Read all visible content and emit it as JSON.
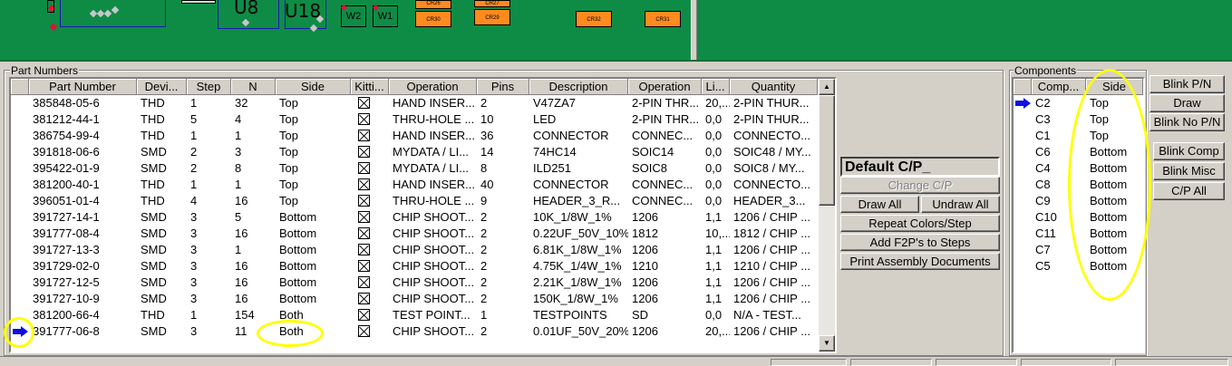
{
  "board": {
    "refs": {
      "u8": "U8",
      "u18": "U18",
      "w2": "W2",
      "w1": "W1"
    },
    "chips": {
      "cr26": "CR26",
      "cr30": "CR30",
      "cr27": "CR27",
      "cr29": "CR29",
      "cr32": "CR32",
      "cr31": "CR31"
    }
  },
  "parts": {
    "group_label": "Part Numbers",
    "columns": [
      "Part Number",
      "Devi...",
      "Step",
      "N",
      "Side",
      "Kitti...",
      "Operation",
      "Pins",
      "Description",
      "Operation",
      "Li...",
      "Quantity"
    ],
    "rows": [
      [
        "385848-05-6",
        "THD",
        "1",
        "32",
        "Top",
        "HAND INSER...",
        "2",
        "V47ZA7",
        "2-PIN THR...",
        "20,...",
        "2-PIN THUR..."
      ],
      [
        "381212-44-1",
        "THD",
        "5",
        "4",
        "Top",
        "THRU-HOLE ...",
        "10",
        "LED",
        "2-PIN THR...",
        "0,0",
        "2-PIN THUR..."
      ],
      [
        "386754-99-4",
        "THD",
        "1",
        "1",
        "Top",
        "HAND INSER...",
        "36",
        "CONNECTOR",
        "CONNEC...",
        "0,0",
        "CONNECTO..."
      ],
      [
        "391818-06-6",
        "SMD",
        "2",
        "3",
        "Top",
        "MYDATA / LI...",
        "14",
        "74HC14",
        "SOIC14",
        "0,0",
        "SOIC48 / MY..."
      ],
      [
        "395422-01-9",
        "SMD",
        "2",
        "8",
        "Top",
        "MYDATA / LI...",
        "8",
        "ILD251",
        "SOIC8",
        "0,0",
        "SOIC8 / MY..."
      ],
      [
        "381200-40-1",
        "THD",
        "1",
        "1",
        "Top",
        "HAND INSER...",
        "40",
        "CONNECTOR",
        "CONNEC...",
        "0,0",
        "CONNECTO..."
      ],
      [
        "396051-01-4",
        "THD",
        "4",
        "16",
        "Top",
        "THRU-HOLE ...",
        "9",
        "HEADER_3_R...",
        "CONNEC...",
        "0,0",
        "HEADER_3..."
      ],
      [
        "391727-14-1",
        "SMD",
        "3",
        "5",
        "Bottom",
        "CHIP SHOOT...",
        "2",
        "10K_1/8W_1%",
        "1206",
        "1,1",
        "1206 / CHIP ..."
      ],
      [
        "391777-08-4",
        "SMD",
        "3",
        "16",
        "Bottom",
        "CHIP SHOOT...",
        "2",
        "0.22UF_50V_10%",
        "1812",
        "10,...",
        "1812 / CHIP ..."
      ],
      [
        "391727-13-3",
        "SMD",
        "3",
        "1",
        "Bottom",
        "CHIP SHOOT...",
        "2",
        "6.81K_1/8W_1%",
        "1206",
        "1,1",
        "1206 / CHIP ..."
      ],
      [
        "391729-02-0",
        "SMD",
        "3",
        "16",
        "Bottom",
        "CHIP SHOOT...",
        "2",
        "4.75K_1/4W_1%",
        "1210",
        "1,1",
        "1210 / CHIP ..."
      ],
      [
        "391727-12-5",
        "SMD",
        "3",
        "16",
        "Bottom",
        "CHIP SHOOT...",
        "2",
        "2.21K_1/8W_1%",
        "1206",
        "1,1",
        "1206 / CHIP ..."
      ],
      [
        "391727-10-9",
        "SMD",
        "3",
        "16",
        "Bottom",
        "CHIP SHOOT...",
        "2",
        "150K_1/8W_1%",
        "1206",
        "1,1",
        "1206 / CHIP ..."
      ],
      [
        "381200-66-4",
        "THD",
        "1",
        "154",
        "Both",
        "TEST POINT...",
        "1",
        "TESTPOINTS",
        "SD",
        "0,0",
        "N/A - TEST..."
      ],
      [
        "391777-06-8",
        "SMD",
        "3",
        "11",
        "Both",
        "CHIP SHOOT...",
        "2",
        "0.01UF_50V_20%",
        "1206",
        "20,...",
        "1206 / CHIP ..."
      ]
    ],
    "selected_row": 14
  },
  "actions": {
    "cp_name": "Default C/P_",
    "change_cp": "Change C/P",
    "draw_all": "Draw All",
    "undraw_all": "Undraw All",
    "repeat_colors": "Repeat Colors/Step",
    "add_f2p": "Add F2P's to Steps",
    "print_docs": "Print Assembly Documents"
  },
  "components": {
    "group_label": "Components",
    "columns": [
      "Comp...",
      "Side"
    ],
    "rows": [
      [
        "C2",
        "Top"
      ],
      [
        "C3",
        "Top"
      ],
      [
        "C1",
        "Top"
      ],
      [
        "C6",
        "Bottom"
      ],
      [
        "C4",
        "Bottom"
      ],
      [
        "C8",
        "Bottom"
      ],
      [
        "C9",
        "Bottom"
      ],
      [
        "C10",
        "Bottom"
      ],
      [
        "C11",
        "Bottom"
      ],
      [
        "C7",
        "Bottom"
      ],
      [
        "C5",
        "Bottom"
      ]
    ],
    "selected_row": 0
  },
  "side_buttons": {
    "blink_pn": "Blink P/N",
    "draw": "Draw",
    "blink_no_pn": "Blink No P/N",
    "blink_comp": "Blink Comp",
    "blink_misc": "Blink Misc",
    "cp_all": "C/P All"
  },
  "colors": {
    "board": "#0e8c46",
    "chip": "#ff8a1e",
    "highlight": "#ffff00",
    "arrow": "#1010e0"
  }
}
